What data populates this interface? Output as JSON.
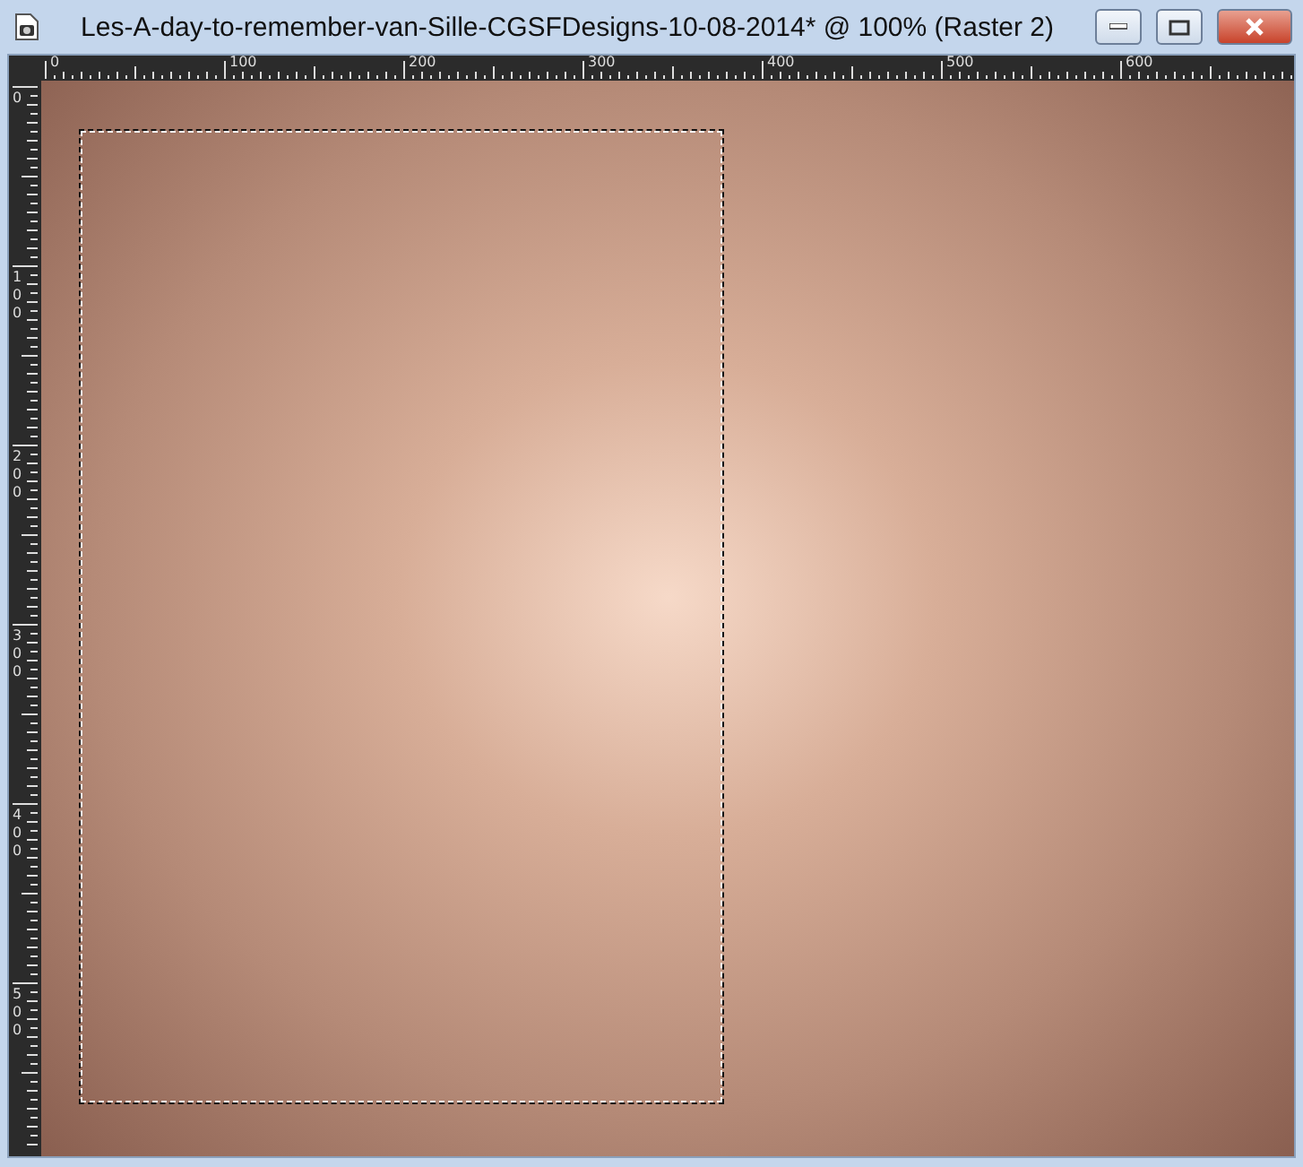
{
  "window": {
    "title": "Les-A-day-to-remember-van-Sille-CGSFDesigns-10-08-2014* @ 100% (Raster 2)"
  },
  "horizontal_ruler": {
    "labels": [
      "0",
      "100",
      "200",
      "300",
      "400",
      "500",
      "600"
    ]
  },
  "vertical_ruler": {
    "labels": [
      "0",
      "100",
      "200",
      "300",
      "400",
      "500"
    ]
  }
}
